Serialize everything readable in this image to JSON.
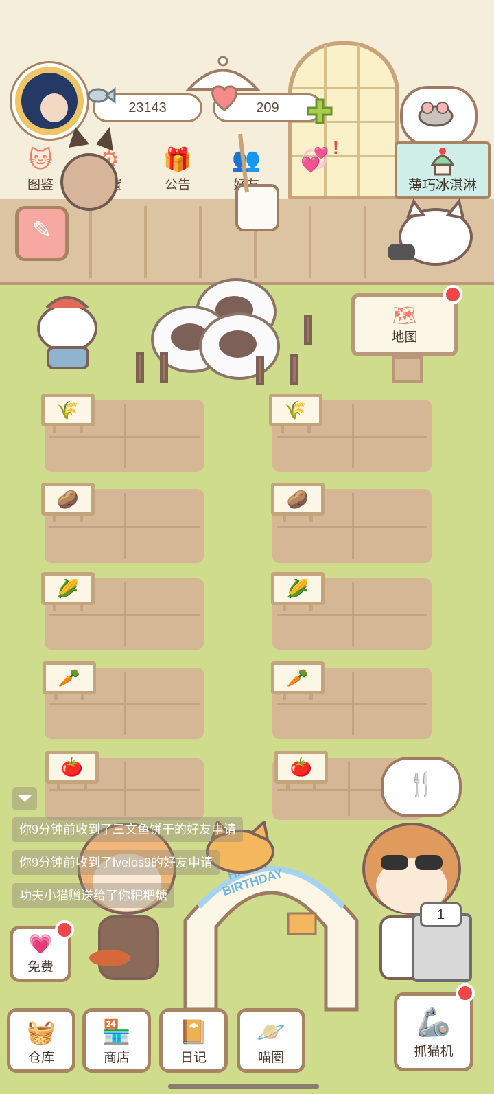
{
  "hud": {
    "fish_currency": "23143",
    "heart_currency": "209",
    "add_icon": "plus-icon",
    "fish_icon": "fish-icon",
    "heart_icon": "heart-icon"
  },
  "top_menu": [
    {
      "label": "图鉴",
      "icon": "cat-head-icon"
    },
    {
      "label": "设置",
      "icon": "gear-icon"
    },
    {
      "label": "公告",
      "icon": "gift-icon"
    },
    {
      "label": "好友",
      "icon": "friends-icon"
    },
    {
      "label": "",
      "icon": "hearts-icon"
    }
  ],
  "event_banner": {
    "label": "薄巧冰淇淋"
  },
  "map_sign": {
    "label": "地图",
    "icon": "map-icon"
  },
  "crops": [
    {
      "left": "wheat",
      "right": "wheat"
    },
    {
      "left": "potato",
      "right": "potato"
    },
    {
      "left": "corn",
      "right": "corn"
    },
    {
      "left": "carrot",
      "right": "carrot"
    },
    {
      "left": "tomato",
      "right": "tomato"
    }
  ],
  "messages": [
    "你9分钟前收到了三文鱼饼干的好友申请",
    "你9分钟前收到了lvelos9的好友申请",
    "功夫小猫赠送给了你粑粑糖"
  ],
  "bottom_buttons": {
    "free": "免费",
    "warehouse": "仓库",
    "shop": "商店",
    "diary": "日记",
    "circle": "喵圈",
    "claw": "抓猫机"
  },
  "machine_count": "1",
  "birthday_text": "HAPPY BIRTHDAY",
  "colors": {
    "grass": "#cfdc8c",
    "soil": "#d6b795",
    "accent": "#f07e68",
    "border": "#a78463",
    "badge": "#ef4747"
  }
}
